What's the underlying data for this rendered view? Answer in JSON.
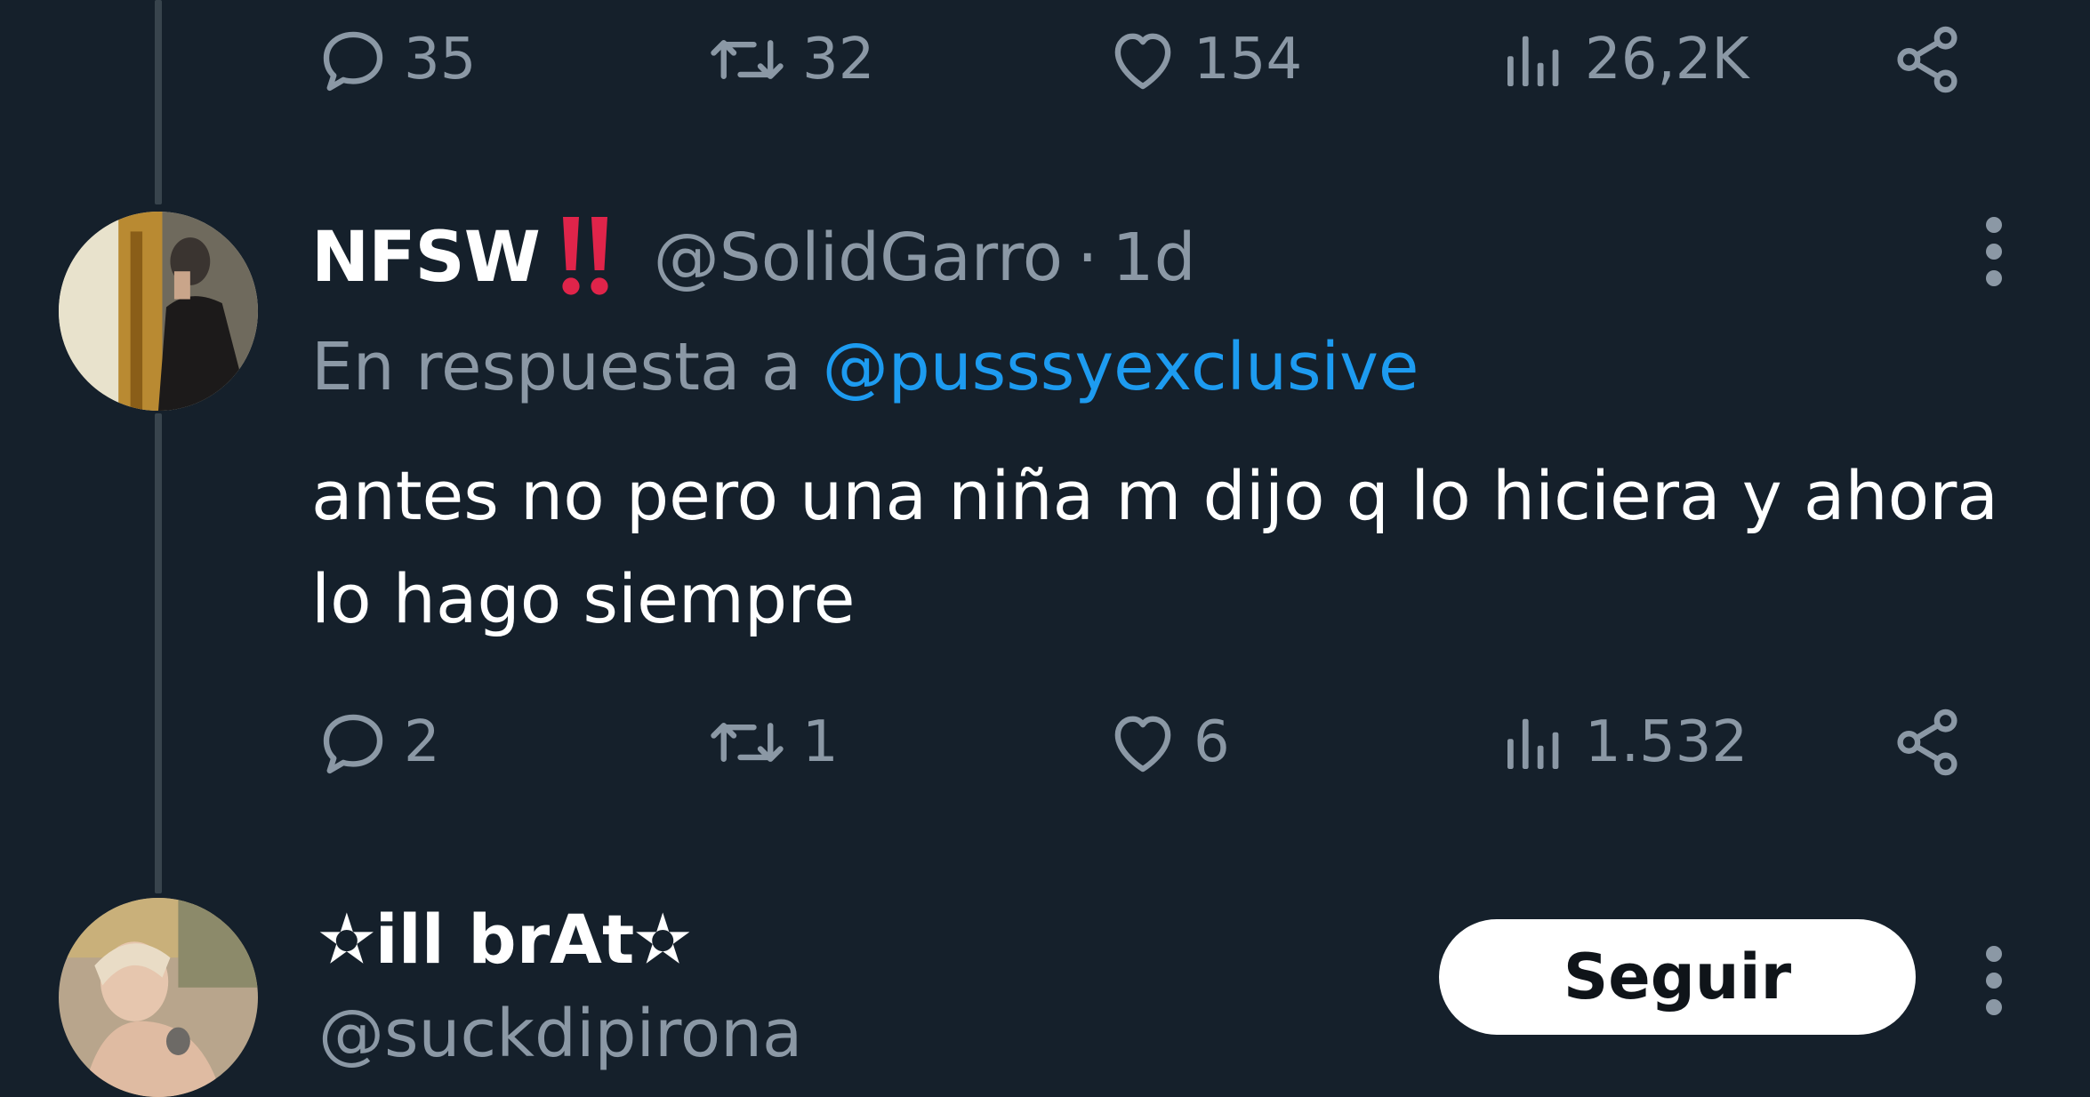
{
  "top_tweet_actions": {
    "replies": "35",
    "retweets": "32",
    "likes": "154",
    "views": "26,2K"
  },
  "reply_tweet": {
    "display_name": "NFSW",
    "handle": "@SolidGarro",
    "separator": "·",
    "time": "1d",
    "reply_prefix": "En respuesta a",
    "reply_mention": "@pusssyexclusive",
    "text": "antes no pero una niña m dijo q lo hiciera y ahora lo hago siempre",
    "actions": {
      "replies": "2",
      "retweets": "1",
      "likes": "6",
      "views": "1.532"
    }
  },
  "suggested_user": {
    "display_name": "✫ill brAt✫",
    "handle": "@suckdipirona",
    "follow_label": "Seguir"
  },
  "icons": {
    "reply": "reply-icon",
    "retweet": "retweet-icon",
    "like": "heart-icon",
    "views": "views-icon",
    "share": "share-icon",
    "more": "more-vertical-icon",
    "alert": "double-exclamation-icon"
  },
  "colors": {
    "background": "#15202b",
    "muted_text": "#8b98a5",
    "link": "#1d9bf0",
    "alert": "#e0244a"
  }
}
